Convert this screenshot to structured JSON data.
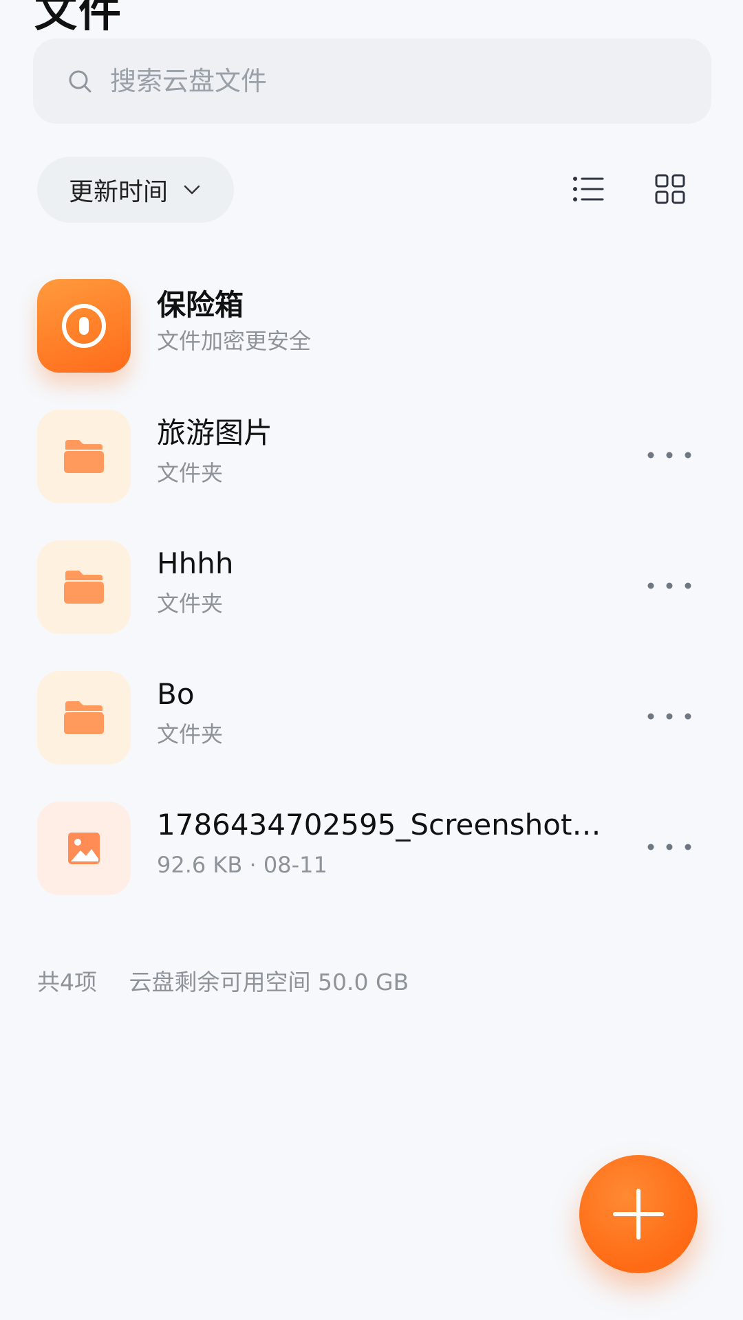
{
  "header": {
    "title": "文件"
  },
  "search": {
    "placeholder": "搜索云盘文件"
  },
  "toolbar": {
    "sort_label": "更新时间",
    "view_icons": [
      "list-view-icon",
      "grid-view-icon"
    ]
  },
  "items": [
    {
      "name": "保险箱",
      "sub": "文件加密更安全",
      "type": "vault",
      "icon": "vault-lock-icon"
    },
    {
      "name": "旅游图片",
      "sub": "文件夹",
      "type": "folder",
      "icon": "folder-icon"
    },
    {
      "name": "Hhhh",
      "sub": "文件夹",
      "type": "folder",
      "icon": "folder-icon"
    },
    {
      "name": "Bo",
      "sub": "文件夹",
      "type": "folder",
      "icon": "folder-icon"
    },
    {
      "name": "1786434702595_Screenshot_2...",
      "sub": "92.6 KB · 08-11",
      "type": "image",
      "icon": "image-icon"
    }
  ],
  "footer": {
    "count": "共4项",
    "space": "云盘剩余可用空间 50.0 GB"
  },
  "fab": {
    "icon": "plus-icon"
  },
  "colors": {
    "accent": "#ff6b1a",
    "folder_bg": "#fff1df",
    "folder_icon": "#ff9a5c",
    "image_bg": "#ffeee6"
  }
}
